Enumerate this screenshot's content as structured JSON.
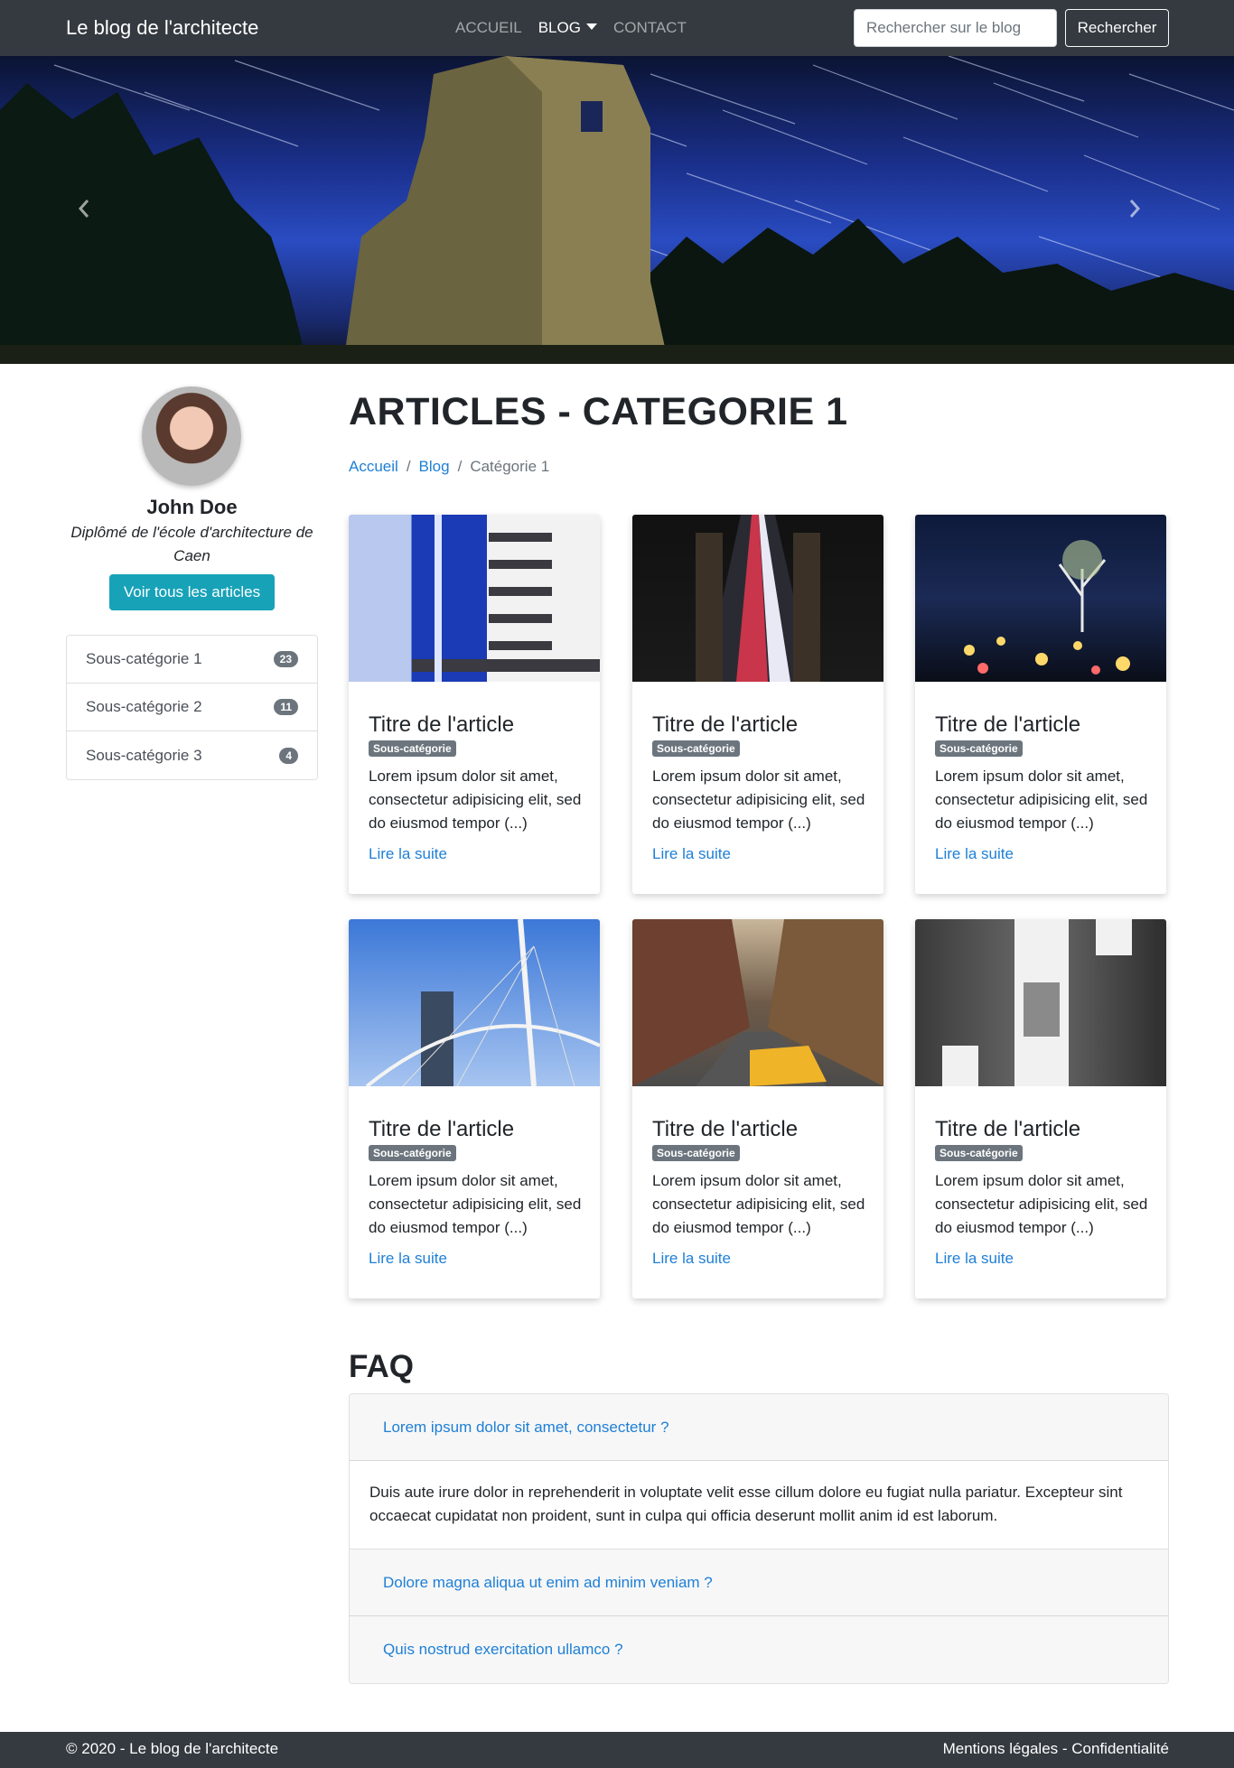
{
  "navbar": {
    "brand": "Le blog de l'architecte",
    "links": [
      "ACCUEIL",
      "BLOG",
      "CONTACT"
    ],
    "search_placeholder": "Rechercher sur le blog",
    "search_button": "Rechercher"
  },
  "sidebar": {
    "author_name": "John Doe",
    "author_desc": "Diplômé de l'école d'architecture de Caen",
    "all_articles_button": "Voir tous les articles",
    "subcategories": [
      {
        "label": "Sous-catégorie 1",
        "count": "23"
      },
      {
        "label": "Sous-catégorie 2",
        "count": "11"
      },
      {
        "label": "Sous-catégorie 3",
        "count": "4"
      }
    ]
  },
  "main": {
    "title": "ARTICLES - CATEGORIE 1",
    "breadcrumb": [
      "Accueil",
      "Blog",
      "Catégorie 1"
    ],
    "articles": [
      {
        "title": "Titre de l'article",
        "badge": "Sous-catégorie",
        "text": "Lorem ipsum dolor sit amet, consectetur adipisicing elit, sed do eiusmod tempor (...)",
        "link": "Lire la suite"
      },
      {
        "title": "Titre de l'article",
        "badge": "Sous-catégorie",
        "text": "Lorem ipsum dolor sit amet, consectetur adipisicing elit, sed do eiusmod tempor (...)",
        "link": "Lire la suite"
      },
      {
        "title": "Titre de l'article",
        "badge": "Sous-catégorie",
        "text": "Lorem ipsum dolor sit amet, consectetur adipisicing elit, sed do eiusmod tempor (...)",
        "link": "Lire la suite"
      },
      {
        "title": "Titre de l'article",
        "badge": "Sous-catégorie",
        "text": "Lorem ipsum dolor sit amet, consectetur adipisicing elit, sed do eiusmod tempor (...)",
        "link": "Lire la suite"
      },
      {
        "title": "Titre de l'article",
        "badge": "Sous-catégorie",
        "text": "Lorem ipsum dolor sit amet, consectetur adipisicing elit, sed do eiusmod tempor (...)",
        "link": "Lire la suite"
      },
      {
        "title": "Titre de l'article",
        "badge": "Sous-catégorie",
        "text": "Lorem ipsum dolor sit amet, consectetur adipisicing elit, sed do eiusmod tempor (...)",
        "link": "Lire la suite"
      }
    ]
  },
  "faq": {
    "title": "FAQ",
    "items": [
      {
        "question": "Lorem ipsum dolor sit amet, consectetur ?",
        "answer": "Duis aute irure dolor in reprehenderit in voluptate velit esse cillum dolore eu fugiat nulla pariatur. Excepteur sint occaecat cupidatat non proident, sunt in culpa qui officia deserunt mollit anim id est laborum."
      },
      {
        "question": "Dolore magna aliqua ut enim ad minim veniam ?"
      },
      {
        "question": "Quis nostrud exercitation ullamco ?"
      }
    ]
  },
  "footer": {
    "copyright": "© 2020 - Le blog de l'architecte",
    "legal": "Mentions légales - Confidentialité"
  },
  "colors": {
    "navbar": "#343a40",
    "link": "#1e7fd6",
    "info_button": "#17a2b8",
    "badge": "#6c757d"
  }
}
